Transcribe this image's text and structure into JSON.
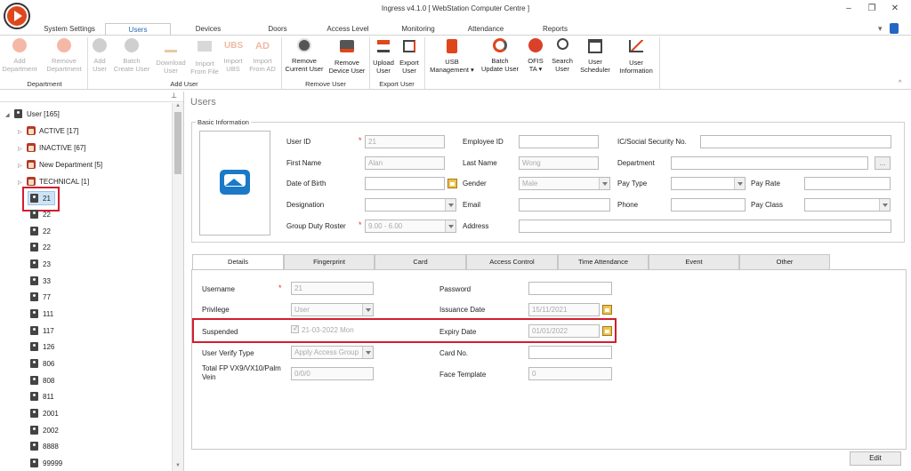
{
  "window": {
    "title": "Ingress v4.1.0 [ WebStation Computer Centre ]",
    "controls": [
      "minimize-icon",
      "restore-icon",
      "close-icon"
    ]
  },
  "ribbon_tabs": [
    "System Settings",
    "Users",
    "Devices",
    "Doors",
    "Access Level",
    "Monitoring",
    "Attendance",
    "Reports"
  ],
  "active_ribbon_tab": "Users",
  "ribbon": {
    "groups": [
      {
        "label": "Department",
        "buttons": [
          {
            "label": "Add\nDepartment",
            "icon": "add-circle-icon",
            "enabled": false
          },
          {
            "label": "Remove\nDepartment",
            "icon": "remove-circle-icon",
            "enabled": false
          }
        ]
      },
      {
        "label": "Add User",
        "buttons": [
          {
            "label": "Add\nUser",
            "icon": "add-user-icon",
            "enabled": false
          },
          {
            "label": "Batch\nCreate User",
            "icon": "batch-user-icon",
            "enabled": false
          },
          {
            "label": "Download\nUser",
            "icon": "download-icon",
            "enabled": false
          },
          {
            "label": "Import\nFrom File",
            "icon": "folder-icon",
            "enabled": false
          },
          {
            "label": "Import\nUBS",
            "icon": "ubs-icon",
            "enabled": false
          },
          {
            "label": "Import\nFrom AD",
            "icon": "ad-icon",
            "enabled": false
          }
        ]
      },
      {
        "label": "Remove User",
        "buttons": [
          {
            "label": "Remove\nCurrent User",
            "icon": "remove-user-icon",
            "enabled": true
          },
          {
            "label": "Remove\nDevice User",
            "icon": "remove-device-user-icon",
            "enabled": true
          }
        ]
      },
      {
        "label": "Export User",
        "buttons": [
          {
            "label": "Upload\nUser",
            "icon": "upload-icon",
            "enabled": true
          },
          {
            "label": "Export\nUser",
            "icon": "export-icon",
            "enabled": true
          }
        ]
      },
      {
        "label": "",
        "buttons": [
          {
            "label": "USB\nManagement ▾",
            "icon": "usb-icon",
            "enabled": true
          },
          {
            "label": "Batch\nUpdate User",
            "icon": "refresh-icon",
            "enabled": true
          },
          {
            "label": "OFIS\nTA ▾",
            "icon": "ofis-icon",
            "enabled": true
          },
          {
            "label": "Search\nUser",
            "icon": "search-icon",
            "enabled": true
          },
          {
            "label": "User\nScheduler",
            "icon": "calendar-icon",
            "enabled": true
          },
          {
            "label": "User\nInformation",
            "icon": "chart-icon",
            "enabled": true
          }
        ]
      }
    ]
  },
  "tree": {
    "root": "User [165]",
    "groups": [
      "ACTIVE [17]",
      "INACTIVE [67]",
      "New Department [5]",
      "TECHNICAL [1]"
    ],
    "users": [
      "21",
      "22",
      "22",
      "22",
      "23",
      "33",
      "77",
      "111",
      "117",
      "126",
      "806",
      "808",
      "811",
      "2001",
      "2002",
      "8888",
      "99999"
    ],
    "selected_user": "21",
    "pin_icon": "pin-icon"
  },
  "main": {
    "title": "Users",
    "basic_info": {
      "legend": "Basic Information",
      "user_id_label": "User ID",
      "user_id": "21",
      "employee_id_label": "Employee ID",
      "employee_id": "",
      "ic_label": "IC/Social Security No.",
      "ic": "",
      "first_name_label": "First Name",
      "first_name": "Alan",
      "last_name_label": "Last Name",
      "last_name": "Wong",
      "department_label": "Department",
      "department": "",
      "department_btn": "...",
      "dob_label": "Date of Birth",
      "dob": "",
      "gender_label": "Gender",
      "gender": "Male",
      "pay_type_label": "Pay Type",
      "pay_type": "",
      "pay_rate_label": "Pay Rate",
      "pay_rate": "",
      "designation_label": "Designation",
      "designation": "",
      "email_label": "Email",
      "email": "",
      "phone_label": "Phone",
      "phone": "",
      "pay_class_label": "Pay Class",
      "pay_class": "",
      "roster_label": "Group Duty Roster",
      "roster": "9.00 - 6.00",
      "address_label": "Address",
      "address": "",
      "required_mark": "*"
    },
    "detail_tabs": [
      "Details",
      "Fingerprint",
      "Card",
      "Access Control",
      "Time Attendance",
      "Event",
      "Other"
    ],
    "active_detail_tab": "Details",
    "details": {
      "username_label": "Username",
      "username": "21",
      "privilege_label": "Privilege",
      "privilege": "User",
      "suspended_label": "Suspended",
      "suspended": "21-03-2022 Mon",
      "verify_label": "User Verify Type",
      "verify": "Apply Access Group",
      "total_fp_label": "Total FP VX9/VX10/Palm\nVein",
      "total_fp": "0/0/0",
      "password_label": "Password",
      "password": "",
      "issuance_label": "Issuance Date",
      "issuance": "15/11/2021",
      "expiry_label": "Expiry Date",
      "expiry": "01/01/2022",
      "card_label": "Card No.",
      "card": "",
      "face_label": "Face Template",
      "face": "0"
    },
    "edit_button": "Edit"
  },
  "colors": {
    "highlight": "#d11f2e",
    "accent_blue": "#2a6ab0",
    "logo_orange": "#e0461c"
  }
}
